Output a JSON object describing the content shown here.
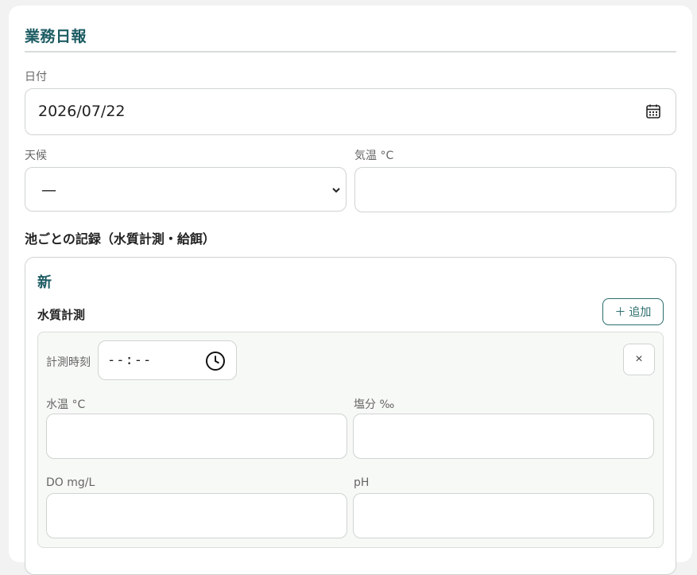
{
  "report": {
    "title": "業務日報",
    "date_label": "日付",
    "date_value": "2026/07/22",
    "weather_label": "天候",
    "weather_selected": "—",
    "temperature_label": "気温 °C",
    "temperature_value": ""
  },
  "ponds": {
    "section_title": "池ごとの記録（水質計測・給餌）",
    "items": [
      {
        "name": "新",
        "water_quality_title": "水質計測",
        "add_button_label": "＋ 追加",
        "measurements": [
          {
            "time_label": "計測時刻",
            "time_value": "--:--",
            "remove_label": "×",
            "water_temp_label": "水温 °C",
            "salinity_label": "塩分 ‰",
            "do_label": "DO mg/L",
            "ph_label": "pH"
          }
        ]
      }
    ]
  },
  "icons": {
    "calendar": "calendar-icon",
    "chevron": "chevron-down-icon",
    "clock": "clock-icon"
  },
  "colors": {
    "accent": "#1d5c63",
    "button_border": "#2c6d6d"
  }
}
